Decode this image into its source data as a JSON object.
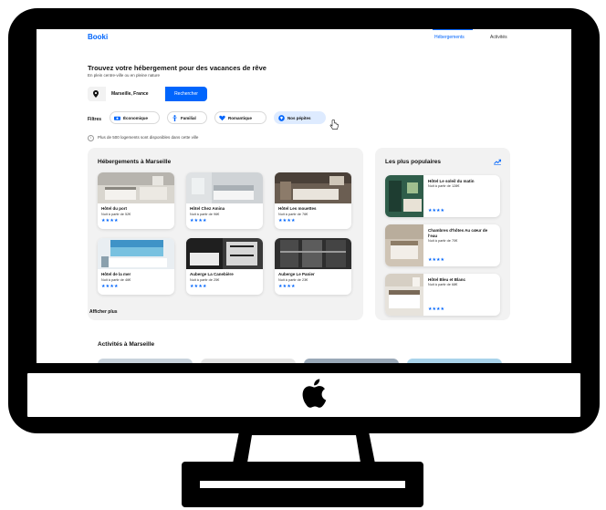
{
  "app": {
    "logo": "Booki",
    "nav": [
      {
        "label": "Hébergements",
        "active": true
      },
      {
        "label": "Activités",
        "active": false
      }
    ]
  },
  "hero": {
    "title": "Trouvez votre hébergement pour des vacances de rêve",
    "subtitle": "En plein centre-ville ou en pleine nature"
  },
  "search": {
    "value": "Marseille, France",
    "button_label": "Rechercher",
    "icon": "location-pin-icon"
  },
  "filters": {
    "label": "Filtres",
    "chips": [
      {
        "label": "Économique",
        "icon": "money-icon",
        "selected": false
      },
      {
        "label": "Familial",
        "icon": "family-icon",
        "selected": false
      },
      {
        "label": "Romantique",
        "icon": "heart-icon",
        "selected": false
      },
      {
        "label": "Nos pépites",
        "icon": "gem-icon",
        "selected": true
      }
    ]
  },
  "info_text": "Plus de 500 logements sont disponibles dans cette ville",
  "accommodations": {
    "title": "Hébergements à Marseille",
    "show_more": "Afficher plus",
    "items": [
      {
        "name": "Hôtel du port",
        "price": "Nuit à partir de 52€",
        "stars": "★★★★",
        "rating": 4
      },
      {
        "name": "Hôtel Chez Amina",
        "price": "Nuit à partir de 96€",
        "stars": "★★★★",
        "rating": 4
      },
      {
        "name": "Hôtel Les mouettes",
        "price": "Nuit à partir de 76€",
        "stars": "★★★★",
        "rating": 4
      },
      {
        "name": "Hôtel de la mer",
        "price": "Nuit à partir de 46€",
        "stars": "★★★★",
        "rating": 4
      },
      {
        "name": "Auberge La Canebière",
        "price": "Nuit à partir de 25€",
        "stars": "★★★★",
        "rating": 4
      },
      {
        "name": "Auberge Le Panier",
        "price": "Nuit à partir de 23€",
        "stars": "★★★★",
        "rating": 4
      }
    ]
  },
  "popular": {
    "title": "Les plus populaires",
    "icon": "trending-icon",
    "items": [
      {
        "name": "Hôtel Le soleil du matin",
        "price": "Nuit à partir de 128€",
        "stars": "★★★★",
        "rating": 4
      },
      {
        "name": "Chambres d'hôtes Au cœur de l'eau",
        "price": "Nuit à partir de 70€",
        "stars": "★★★★",
        "rating": 4
      },
      {
        "name": "Hôtel Bleu et Blanc",
        "price": "Nuit à partir de 68€",
        "stars": "★★★★",
        "rating": 4
      }
    ]
  },
  "activities": {
    "title": "Activités à Marseille"
  },
  "colors": {
    "accent": "#0065fc",
    "panel": "#f2f2f2",
    "chip_selected": "#deebff",
    "frame": "#000000"
  }
}
